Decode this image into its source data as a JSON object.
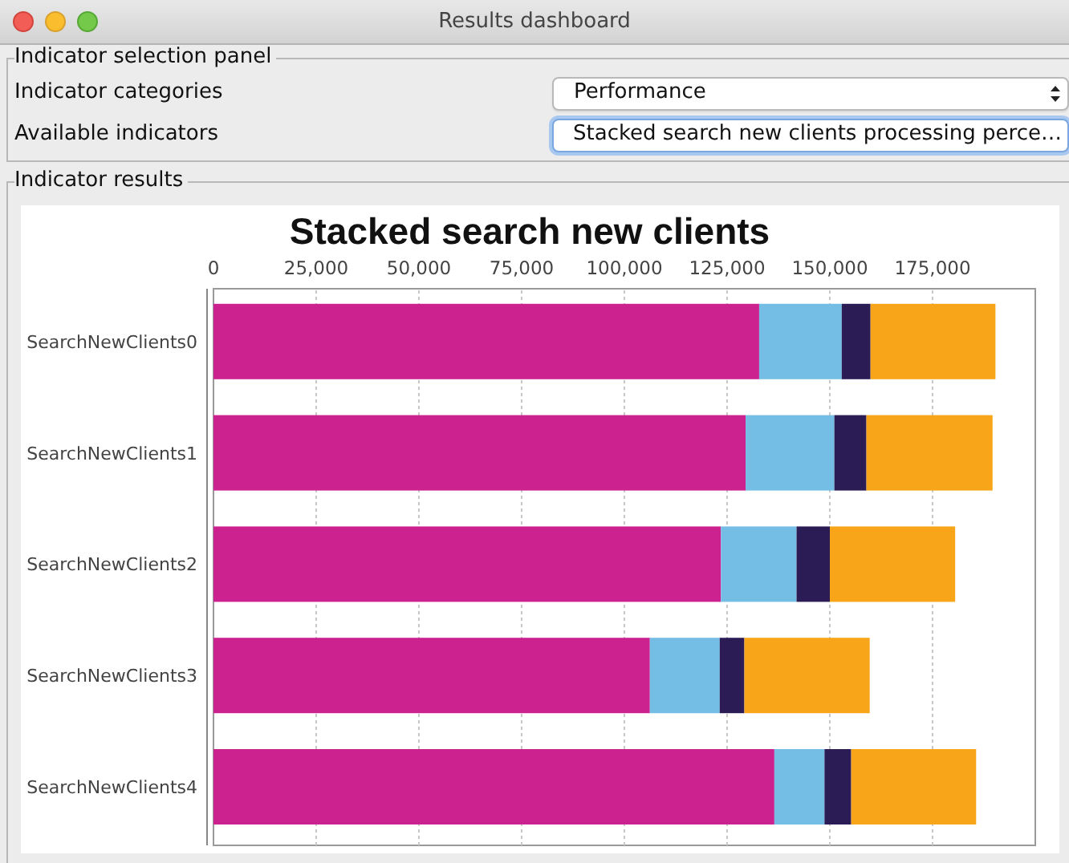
{
  "window": {
    "title": "Results dashboard"
  },
  "selection_panel": {
    "title": "Indicator selection panel",
    "fields": [
      {
        "label": "Indicator categories",
        "value": "Performance",
        "focused": false
      },
      {
        "label": "Available indicators",
        "value": "Stacked search new clients processing perce…",
        "focused": true
      }
    ]
  },
  "results_panel": {
    "title": "Indicator results",
    "chart_data": {
      "type": "bar",
      "orientation": "horizontal",
      "stacked": true,
      "title": "Stacked search new clients",
      "categories": [
        "SearchNewClients0",
        "SearchNewClients1",
        "SearchNewClients2",
        "SearchNewClients3",
        "SearchNewClients4"
      ],
      "series": [
        {
          "color": "#cc2290",
          "values": [
            132800,
            129500,
            123500,
            106200,
            136500
          ]
        },
        {
          "color": "#74bde4",
          "values": [
            20100,
            21600,
            18400,
            17000,
            12200
          ]
        },
        {
          "color": "#2b1c55",
          "values": [
            7000,
            7800,
            8100,
            6000,
            6500
          ]
        },
        {
          "color": "#f9a51a",
          "values": [
            30400,
            30700,
            30500,
            30500,
            30400
          ]
        }
      ],
      "xlim": [
        0,
        200000
      ],
      "grid": true,
      "xticks": [
        {
          "value": 0,
          "label": "0"
        },
        {
          "value": 25000,
          "label": "25,000"
        },
        {
          "value": 50000,
          "label": "50,000"
        },
        {
          "value": 75000,
          "label": "75,000"
        },
        {
          "value": 100000,
          "label": "100,000"
        },
        {
          "value": 125000,
          "label": "125,000"
        },
        {
          "value": 150000,
          "label": "150,000"
        },
        {
          "value": 175000,
          "label": "175,000"
        }
      ]
    }
  }
}
